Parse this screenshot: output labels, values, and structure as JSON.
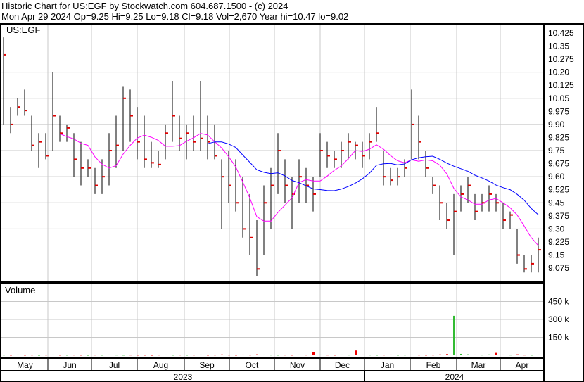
{
  "header": {
    "title": "Historic Chart for US:EGF by Stockwatch.com 604.687.1500 - (c) 2024",
    "quote": "Mon Apr 29 2024  Op=9.25  Hi=9.25  Lo=9.18  Cl=9.18  Vol=2,670  Year hi=10.47  lo=9.02"
  },
  "chart_data": {
    "type": "ohlc",
    "symbol": "US:EGF",
    "volume_label": "Volume",
    "price_ticks": [
      "10.425",
      "10.35",
      "10.275",
      "10.20",
      "10.125",
      "10.05",
      "9.975",
      "9.90",
      "9.825",
      "9.75",
      "9.675",
      "9.60",
      "9.525",
      "9.45",
      "9.375",
      "9.30",
      "9.225",
      "9.15",
      "9.075"
    ],
    "ylim": [
      9.0,
      10.48
    ],
    "volume_ticks": [
      "450 k",
      "300 k",
      "150 k"
    ],
    "volume_tick_values": [
      450,
      300,
      150
    ],
    "months": [
      "May",
      "Jun",
      "Jul",
      "Aug",
      "Sep",
      "Oct",
      "Nov",
      "Dec",
      "Jan",
      "Feb",
      "Mar",
      "Apr"
    ],
    "years": [
      "2023",
      "2024"
    ],
    "colors": {
      "bar": "#000000",
      "close": "#e00000",
      "ma_short": "#ff00ff",
      "ma_long": "#0000ff",
      "vol_up": "#33bb33",
      "vol_down": "#ee0000",
      "grid": "#c8c8c8"
    },
    "bars_hlc": [
      [
        10.4,
        9.9,
        10.3
      ],
      [
        10.0,
        9.85,
        9.9
      ],
      [
        10.05,
        9.95,
        10.0
      ],
      [
        10.1,
        9.95,
        9.98
      ],
      [
        9.95,
        9.75,
        9.78
      ],
      [
        9.85,
        9.65,
        9.8
      ],
      [
        9.85,
        9.7,
        9.72
      ],
      [
        10.2,
        9.75,
        9.95
      ],
      [
        9.95,
        9.8,
        9.85
      ],
      [
        9.9,
        9.8,
        9.88
      ],
      [
        9.85,
        9.6,
        9.7
      ],
      [
        9.8,
        9.55,
        9.65
      ],
      [
        9.7,
        9.6,
        9.65
      ],
      [
        9.65,
        9.5,
        9.55
      ],
      [
        9.7,
        9.5,
        9.6
      ],
      [
        9.85,
        9.55,
        9.75
      ],
      [
        9.95,
        9.65,
        9.78
      ],
      [
        10.12,
        9.75,
        10.05
      ],
      [
        10.1,
        9.8,
        9.95
      ],
      [
        10.0,
        9.7,
        9.8
      ],
      [
        9.95,
        9.65,
        9.7
      ],
      [
        9.8,
        9.65,
        9.68
      ],
      [
        9.75,
        9.65,
        9.67
      ],
      [
        9.9,
        9.7,
        9.85
      ],
      [
        10.15,
        9.8,
        9.95
      ],
      [
        9.95,
        9.75,
        9.82
      ],
      [
        9.9,
        9.7,
        9.85
      ],
      [
        9.95,
        9.75,
        9.8
      ],
      [
        10.15,
        9.75,
        9.82
      ],
      [
        9.95,
        9.7,
        9.8
      ],
      [
        9.9,
        9.7,
        9.72
      ],
      [
        9.7,
        9.3,
        9.6
      ],
      [
        9.75,
        9.45,
        9.55
      ],
      [
        9.7,
        9.4,
        9.45
      ],
      [
        9.6,
        9.25,
        9.3
      ],
      [
        9.5,
        9.15,
        9.25
      ],
      [
        9.35,
        9.03,
        9.07
      ],
      [
        9.55,
        9.15,
        9.45
      ],
      [
        9.65,
        9.3,
        9.55
      ],
      [
        9.85,
        9.5,
        9.75
      ],
      [
        9.7,
        9.45,
        9.55
      ],
      [
        9.6,
        9.3,
        9.5
      ],
      [
        9.7,
        9.45,
        9.6
      ],
      [
        9.65,
        9.45,
        9.55
      ],
      [
        9.6,
        9.4,
        9.5
      ],
      [
        9.85,
        9.6,
        9.75
      ],
      [
        9.8,
        9.65,
        9.72
      ],
      [
        9.75,
        9.65,
        9.7
      ],
      [
        9.8,
        9.65,
        9.75
      ],
      [
        9.85,
        9.7,
        9.8
      ],
      [
        9.8,
        9.7,
        9.78
      ],
      [
        9.8,
        9.65,
        9.72
      ],
      [
        9.85,
        9.7,
        9.8
      ],
      [
        10.0,
        9.8,
        9.85
      ],
      [
        9.75,
        9.55,
        9.6
      ],
      [
        9.65,
        9.55,
        9.58
      ],
      [
        9.65,
        9.55,
        9.6
      ],
      [
        9.7,
        9.6,
        9.65
      ],
      [
        10.1,
        9.7,
        9.9
      ],
      [
        9.95,
        9.7,
        9.8
      ],
      [
        9.75,
        9.6,
        9.65
      ],
      [
        9.6,
        9.5,
        9.55
      ],
      [
        9.55,
        9.35,
        9.45
      ],
      [
        9.45,
        9.3,
        9.35
      ],
      [
        9.5,
        9.15,
        9.4
      ],
      [
        9.55,
        9.4,
        9.5
      ],
      [
        9.6,
        9.45,
        9.55
      ],
      [
        9.5,
        9.35,
        9.4
      ],
      [
        9.5,
        9.4,
        9.45
      ],
      [
        9.55,
        9.4,
        9.5
      ],
      [
        9.5,
        9.4,
        9.45
      ],
      [
        9.45,
        9.3,
        9.35
      ],
      [
        9.4,
        9.3,
        9.38
      ],
      [
        9.3,
        9.1,
        9.15
      ],
      [
        9.15,
        9.05,
        9.07
      ],
      [
        9.15,
        9.05,
        9.1
      ],
      [
        9.25,
        9.05,
        9.18
      ]
    ],
    "volume_k": [
      5,
      4,
      6,
      4,
      5,
      3,
      5,
      6,
      4,
      4,
      5,
      4,
      3,
      5,
      4,
      6,
      5,
      4,
      5,
      4,
      4,
      3,
      5,
      6,
      4,
      5,
      4,
      5,
      6,
      4,
      5,
      7,
      5,
      4,
      6,
      5,
      8,
      6,
      5,
      4,
      5,
      4,
      6,
      5,
      25,
      6,
      5,
      4,
      6,
      5,
      40,
      6,
      5,
      4,
      5,
      6,
      4,
      5,
      6,
      5,
      4,
      5,
      7,
      10,
      330,
      12,
      8,
      6,
      5,
      7,
      20,
      6,
      5,
      8,
      5,
      4,
      6
    ]
  }
}
